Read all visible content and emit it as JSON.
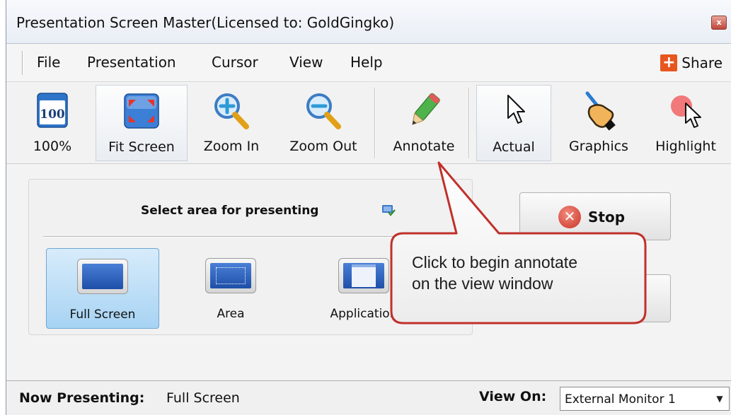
{
  "window": {
    "title": "Presentation Screen Master(Licensed to: GoldGingko)",
    "close_label": "x"
  },
  "menu": {
    "items": [
      "File",
      "Presentation",
      "Cursor",
      "View",
      "Help"
    ],
    "share_label": "Share",
    "share_icon_glyph": "+"
  },
  "toolbar": {
    "tools": [
      {
        "label": "100%",
        "icon": "zoom-100-icon",
        "icon_text": "100"
      },
      {
        "label": "Fit Screen",
        "icon": "fit-screen-icon"
      },
      {
        "label": "Zoom In",
        "icon": "zoom-in-icon"
      },
      {
        "label": "Zoom Out",
        "icon": "zoom-out-icon"
      },
      {
        "label": "Annotate",
        "icon": "pencil-icon"
      },
      {
        "label": "Actual",
        "icon": "arrow-cursor-icon"
      },
      {
        "label": "Graphics",
        "icon": "graphics-hand-icon"
      },
      {
        "label": "Highlight",
        "icon": "highlight-cursor-icon"
      }
    ]
  },
  "select_area": {
    "title": "Select area for presenting",
    "modes": [
      {
        "label": "Full Screen",
        "selected": true
      },
      {
        "label": "Area",
        "selected": false
      },
      {
        "label": "Application",
        "selected": false
      }
    ]
  },
  "actions": {
    "stop_label": "Stop",
    "stop_icon_glyph": "✕"
  },
  "callout": {
    "line1": "Click to begin annotate",
    "line2": "on the view window"
  },
  "status": {
    "now_presenting_label": "Now Presenting:",
    "now_presenting_value": "Full Screen",
    "view_on_label": "View On:",
    "view_on_value": "External Monitor 1",
    "dropdown_glyph": "▼"
  },
  "colors": {
    "callout_border": "#c0302b",
    "selected_mode": "#a7d3f3",
    "accent_orange": "#e8561f"
  }
}
